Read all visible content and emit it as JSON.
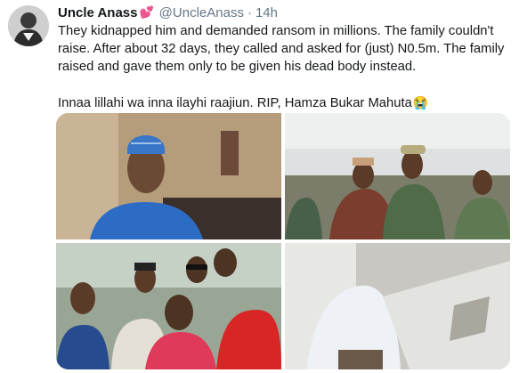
{
  "tweet": {
    "author": {
      "name": "Uncle Anass",
      "emoji": "💕",
      "handle": "@UncleAnass",
      "separator": "·",
      "time": "14h"
    },
    "text": {
      "paragraph1": "They kidnapped him and demanded ransom in millions. The family couldn't raise. After about 32 days, they called and asked for (just) N0.5m. The family raised and gave them only to be given his dead body instead.",
      "paragraph2": "Innaa lillahi wa inna ilayhi raajiun. RIP, Hamza Bukar Mahuta",
      "paragraph2_emoji": "😭"
    }
  },
  "colors": {
    "text": "#14171a",
    "muted": "#657786",
    "heart": "#e0245e"
  }
}
